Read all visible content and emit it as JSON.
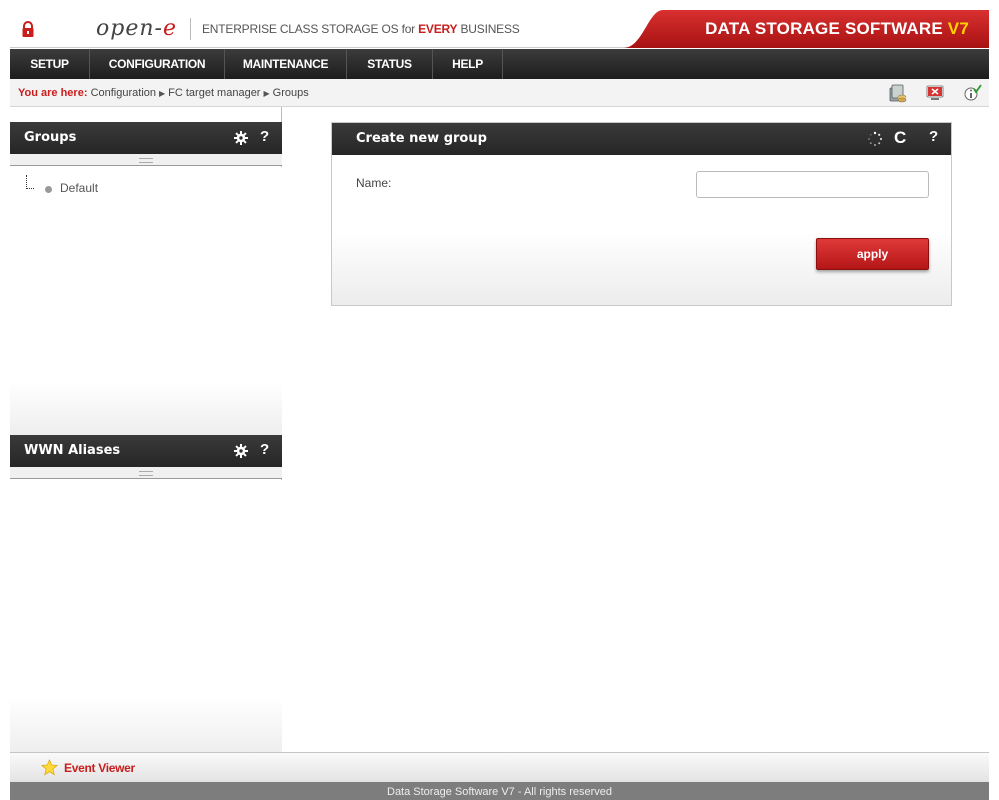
{
  "header": {
    "logo_text": "open-",
    "logo_e": "e",
    "tagline_prefix": "ENTERPRISE CLASS STORAGE OS for ",
    "tagline_highlight": "EVERY",
    "tagline_suffix": " BUSINESS",
    "brand": "DATA STORAGE SOFTWARE ",
    "brand_version": "V7",
    "lock_icon": "lock-icon"
  },
  "menu": {
    "items": [
      {
        "label": "SETUP"
      },
      {
        "label": "CONFIGURATION"
      },
      {
        "label": "MAINTENANCE"
      },
      {
        "label": "STATUS"
      },
      {
        "label": "HELP"
      }
    ]
  },
  "breadcrumb": {
    "label": "You are here:",
    "items": [
      "Configuration",
      "FC target manager",
      "Groups"
    ],
    "toolbar_icons": [
      "database-icon",
      "logout-icon",
      "info-icon"
    ]
  },
  "groups_panel": {
    "title": "Groups",
    "help": "?",
    "tree": [
      {
        "label": "Default"
      }
    ]
  },
  "wwn_panel": {
    "title": "WWN Aliases",
    "help": "?"
  },
  "create_panel": {
    "title": "Create new group",
    "refresh": "C",
    "help": "?",
    "name_label": "Name:",
    "name_value": "",
    "apply_label": "apply"
  },
  "event_viewer": {
    "label": "Event Viewer",
    "icon": "star-icon"
  },
  "footer": {
    "text": "Data Storage Software V7 - All rights reserved"
  },
  "colors": {
    "accent_red": "#c81e1e",
    "menu_dark": "#262626",
    "version_yellow": "#ffd200"
  }
}
